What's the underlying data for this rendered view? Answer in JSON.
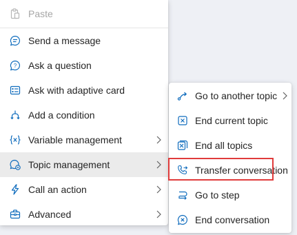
{
  "main_menu": {
    "paste": "Paste",
    "send_message": "Send a message",
    "ask_question": "Ask a question",
    "ask_adaptive_card": "Ask with adaptive card",
    "add_condition": "Add a condition",
    "variable_management": "Variable management",
    "topic_management": "Topic management",
    "call_action": "Call an action",
    "advanced": "Advanced"
  },
  "sub_menu": {
    "go_to_another_topic": "Go to another topic",
    "end_current_topic": "End current topic",
    "end_all_topics": "End all topics",
    "transfer_conversation": "Transfer conversation",
    "go_to_step": "Go to step",
    "end_conversation": "End conversation"
  },
  "icons": {
    "paste": "clipboard-icon",
    "send_message": "chat-bubble-icon",
    "ask_question": "question-bubble-icon",
    "ask_adaptive_card": "card-icon",
    "add_condition": "branch-icon",
    "variable_management": "variable-icon",
    "topic_management": "chat-settings-icon",
    "call_action": "lightning-icon",
    "advanced": "toolbox-icon",
    "go_to_another_topic": "redirect-icon",
    "end_current_topic": "square-x-icon",
    "end_all_topics": "multi-square-x-icon",
    "transfer_conversation": "phone-transfer-icon",
    "go_to_step": "loop-arrow-icon",
    "end_conversation": "chat-x-icon"
  },
  "colors": {
    "icon_accent": "#0f6cbd",
    "highlight_border": "#e03b3b",
    "active_row_bg": "#ebebeb"
  }
}
